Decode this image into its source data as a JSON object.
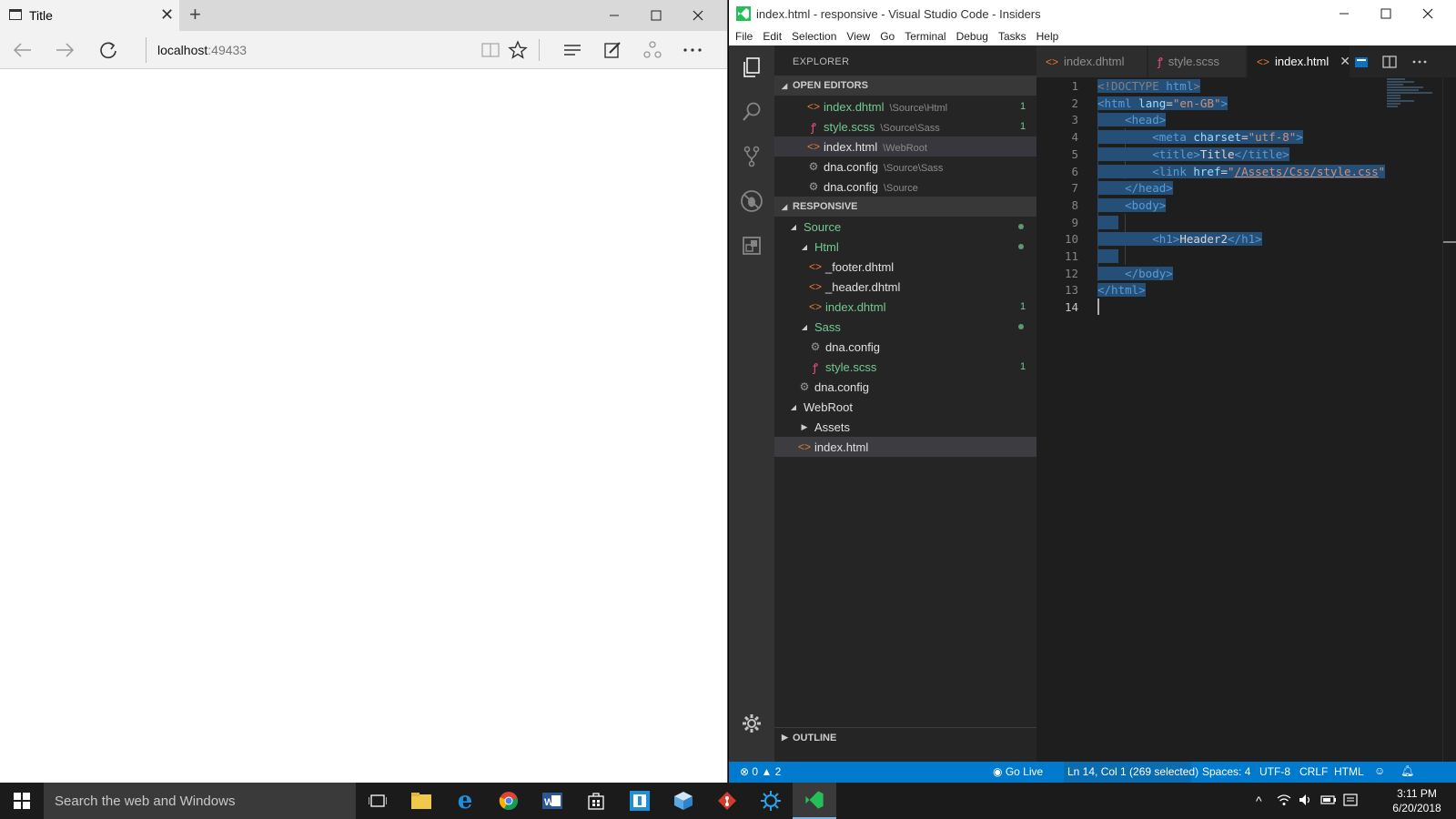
{
  "browser": {
    "tab_title": "Title",
    "address_host": "localhost",
    "address_port": ":49433"
  },
  "vscode": {
    "window_title": "index.html - responsive - Visual Studio Code - Insiders",
    "menu": [
      "File",
      "Edit",
      "Selection",
      "View",
      "Go",
      "Terminal",
      "Debug",
      "Tasks",
      "Help"
    ],
    "explorer_title": "EXPLORER",
    "open_editors_title": "OPEN EDITORS",
    "open_editors": [
      {
        "name": "index.dhtml",
        "path": "\\Source\\Html",
        "count": "1"
      },
      {
        "name": "style.scss",
        "path": "\\Source\\Sass",
        "count": "1"
      },
      {
        "name": "index.html",
        "path": "\\WebRoot",
        "count": ""
      },
      {
        "name": "dna.config",
        "path": "\\Source\\Sass",
        "count": ""
      },
      {
        "name": "dna.config",
        "path": "\\Source",
        "count": ""
      }
    ],
    "project_title": "RESPONSIVE",
    "tree": [
      {
        "name": "Source",
        "count": ""
      },
      {
        "name": "Html",
        "count": ""
      },
      {
        "name": "_footer.dhtml",
        "count": ""
      },
      {
        "name": "_header.dhtml",
        "count": ""
      },
      {
        "name": "index.dhtml",
        "count": "1"
      },
      {
        "name": "Sass",
        "count": ""
      },
      {
        "name": "dna.config",
        "count": ""
      },
      {
        "name": "style.scss",
        "count": "1"
      },
      {
        "name": "dna.config",
        "count": ""
      },
      {
        "name": "WebRoot",
        "count": ""
      },
      {
        "name": "Assets",
        "count": ""
      },
      {
        "name": "index.html",
        "count": ""
      }
    ],
    "outline_title": "OUTLINE",
    "tabs": [
      "index.dhtml",
      "style.scss",
      "index.html"
    ],
    "line_numbers": [
      "1",
      "2",
      "3",
      "4",
      "5",
      "6",
      "7",
      "8",
      "9",
      "10",
      "11",
      "12",
      "13",
      "14"
    ],
    "code": {
      "l1_a": "<!DOCTYPE",
      "l1_b": " html",
      "l1_c": ">",
      "l2_a": "<html",
      "l2_b": " lang",
      "l2_c": "=",
      "l2_d": "\"en-GB\"",
      "l2_e": ">",
      "l3_a": "<head",
      "l3_b": ">",
      "l4_a": "<meta",
      "l4_b": " charset",
      "l4_c": "=",
      "l4_d": "\"utf-8\"",
      "l4_e": ">",
      "l5_a": "<title",
      "l5_b": ">",
      "l5_c": "Title",
      "l5_d": "</title",
      "l5_e": ">",
      "l6_a": "<link",
      "l6_b": " href",
      "l6_c": "=",
      "l6_d": "\"",
      "l6_e": "/Assets/Css/style.css",
      "l6_f": "\"",
      "l7_a": "</head",
      "l7_b": ">",
      "l8_a": "<body",
      "l8_b": ">",
      "l10_a": "<h1",
      "l10_b": ">",
      "l10_c": "Header2",
      "l10_d": "</h1",
      "l10_e": ">",
      "l12_a": "</body",
      "l12_b": ">",
      "l13_a": "</html",
      "l13_b": ">"
    },
    "status": {
      "errors": "0",
      "warnings": "2",
      "go_live": "Go Live",
      "position": "Ln 14, Col 1 (269 selected)",
      "spaces": "Spaces: 4",
      "encoding": "UTF-8",
      "eol": "CRLF",
      "language": "HTML"
    }
  },
  "taskbar": {
    "search_placeholder": "Search the web and Windows",
    "time": "3:11 PM",
    "date": "6/20/2018"
  },
  "colors": {
    "vscode_accent": "#007acc",
    "html_icon": "#e37933",
    "scss_icon": "#f55385",
    "git_added": "#73c991"
  }
}
